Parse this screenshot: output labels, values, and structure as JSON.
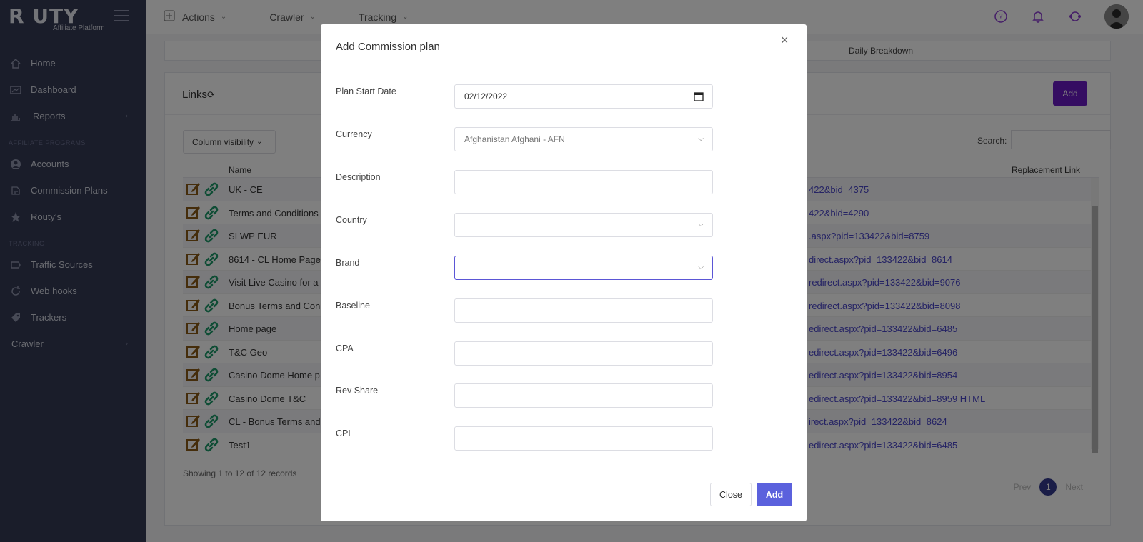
{
  "brand": {
    "logo": "R UTY",
    "subtitle": "Affiliate Platform"
  },
  "sidebar": {
    "items": [
      {
        "label": "Home"
      },
      {
        "label": "Dashboard"
      },
      {
        "label": "Reports"
      }
    ],
    "section_affiliate": "AFFILIATE PROGRAMS",
    "affiliate_items": [
      {
        "label": "Accounts"
      },
      {
        "label": "Commission Plans"
      },
      {
        "label": "Routy's"
      }
    ],
    "section_tracking": "TRACKING",
    "tracking_items": [
      {
        "label": "Traffic Sources"
      },
      {
        "label": "Web hooks"
      },
      {
        "label": "Trackers"
      }
    ],
    "crawler": "Crawler"
  },
  "topbar": {
    "menu": [
      {
        "label": "Actions"
      },
      {
        "label": "Crawler"
      },
      {
        "label": "Tracking"
      }
    ]
  },
  "main": {
    "tab_daily": "Daily Breakdown",
    "card_title": "Links",
    "add_label": "Add",
    "column_visibility": "Column visibility",
    "search_label": "Search:",
    "headers": {
      "name": "Name",
      "replacement": "Replacement Link"
    },
    "rows": [
      {
        "name": "UK - CE",
        "url": "422&bid=4375"
      },
      {
        "name": "Terms and Conditions",
        "url": "422&bid=4290"
      },
      {
        "name": "SI WP EUR",
        "url": ".aspx?pid=133422&bid=8759"
      },
      {
        "name": "8614 - CL Home Page",
        "url": "direct.aspx?pid=133422&bid=8614"
      },
      {
        "name": "Visit Live Casino for a",
        "url": "redirect.aspx?pid=133422&bid=9076"
      },
      {
        "name": "Bonus Terms and Con",
        "url": "redirect.aspx?pid=133422&bid=8098"
      },
      {
        "name": "Home page",
        "url": "edirect.aspx?pid=133422&bid=6485"
      },
      {
        "name": "T&C Geo",
        "url": "edirect.aspx?pid=133422&bid=6496"
      },
      {
        "name": "Casino Dome Home p",
        "url": "edirect.aspx?pid=133422&bid=8954"
      },
      {
        "name": "Casino Dome T&C",
        "url": "edirect.aspx?pid=133422&bid=8959 HTML"
      },
      {
        "name": "CL - Bonus Terms and",
        "url": "irect.aspx?pid=133422&bid=8624"
      },
      {
        "name": "Test1",
        "url": "edirect.aspx?pid=133422&bid=6485"
      }
    ],
    "showing": "Showing 1 to 12 of 12 records",
    "pager": {
      "prev": "Prev",
      "current": "1",
      "next": "Next"
    }
  },
  "modal": {
    "title": "Add Commission plan",
    "fields": {
      "plan_start_date": {
        "label": "Plan Start Date",
        "value": "02/12/2022"
      },
      "currency": {
        "label": "Currency",
        "value": "Afghanistan Afghani - AFN"
      },
      "description": {
        "label": "Description",
        "value": ""
      },
      "country": {
        "label": "Country",
        "value": ""
      },
      "brand": {
        "label": "Brand",
        "value": ""
      },
      "baseline": {
        "label": "Baseline",
        "value": ""
      },
      "cpa": {
        "label": "CPA",
        "value": ""
      },
      "rev_share": {
        "label": "Rev Share",
        "value": ""
      },
      "cpl": {
        "label": "CPL",
        "value": ""
      }
    },
    "close_label": "Close",
    "add_label": "Add"
  },
  "colors": {
    "sidebar": "#353a55",
    "accent": "#6a1ac4",
    "primary_button": "#5b61dd",
    "link": "#4a46c9"
  }
}
